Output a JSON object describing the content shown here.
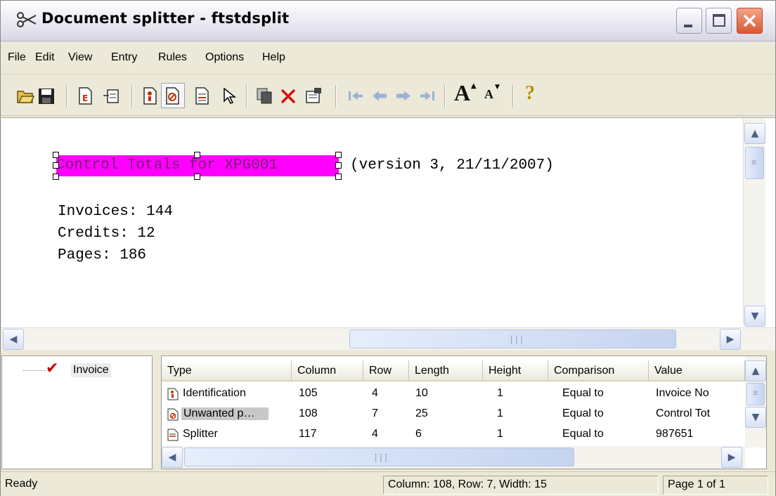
{
  "window": {
    "title": "Document splitter - ftstdsplit"
  },
  "menu": [
    "File",
    "Edit",
    "View",
    "Entry",
    "Rules",
    "Options",
    "Help"
  ],
  "toolbar": {
    "icons": [
      "open-folder-icon",
      "save-icon",
      "edit-entry-icon",
      "insert-field-icon",
      "identification-rule-icon",
      "unwanted-page-rule-icon",
      "splitter-rule-icon",
      "pointer-icon",
      "copy-icon",
      "delete-icon",
      "properties-icon",
      "first-page-icon",
      "previous-page-icon",
      "next-page-icon",
      "last-page-icon",
      "larger-font-icon",
      "smaller-font-icon",
      "help-icon"
    ],
    "larger_font_glyph": "A",
    "smaller_font_glyph": "A",
    "help_glyph": "?"
  },
  "document": {
    "highlighted_text": "Control Totals for XPG001",
    "header_rest": "(version 3, 21/11/2007)",
    "lines": [
      "Invoices: 144",
      "Credits: 12",
      "Pages: 186"
    ]
  },
  "tree": {
    "item": "Invoice"
  },
  "rules_table": {
    "columns": [
      "Type",
      "Column",
      "Row",
      "Length",
      "Height",
      "Comparison",
      "Value"
    ],
    "rows": [
      {
        "type": "Identification",
        "column": "105",
        "row": "4",
        "length": "10",
        "height": "1",
        "comparison": "Equal to",
        "value": "Invoice No"
      },
      {
        "type": "Unwanted p…",
        "column": "108",
        "row": "7",
        "length": "25",
        "height": "1",
        "comparison": "Equal to",
        "value": "Control Tot"
      },
      {
        "type": "Splitter",
        "column": "117",
        "row": "4",
        "length": "6",
        "height": "1",
        "comparison": "Equal to",
        "value": "987651"
      }
    ]
  },
  "status": {
    "left": "Ready",
    "position": "Column: 108, Row: 7, Width: 15",
    "page": "Page 1 of 1"
  },
  "colors": {
    "highlight": "#ff00ff",
    "close_button": "#d9572f",
    "accent": "#4d6185"
  }
}
